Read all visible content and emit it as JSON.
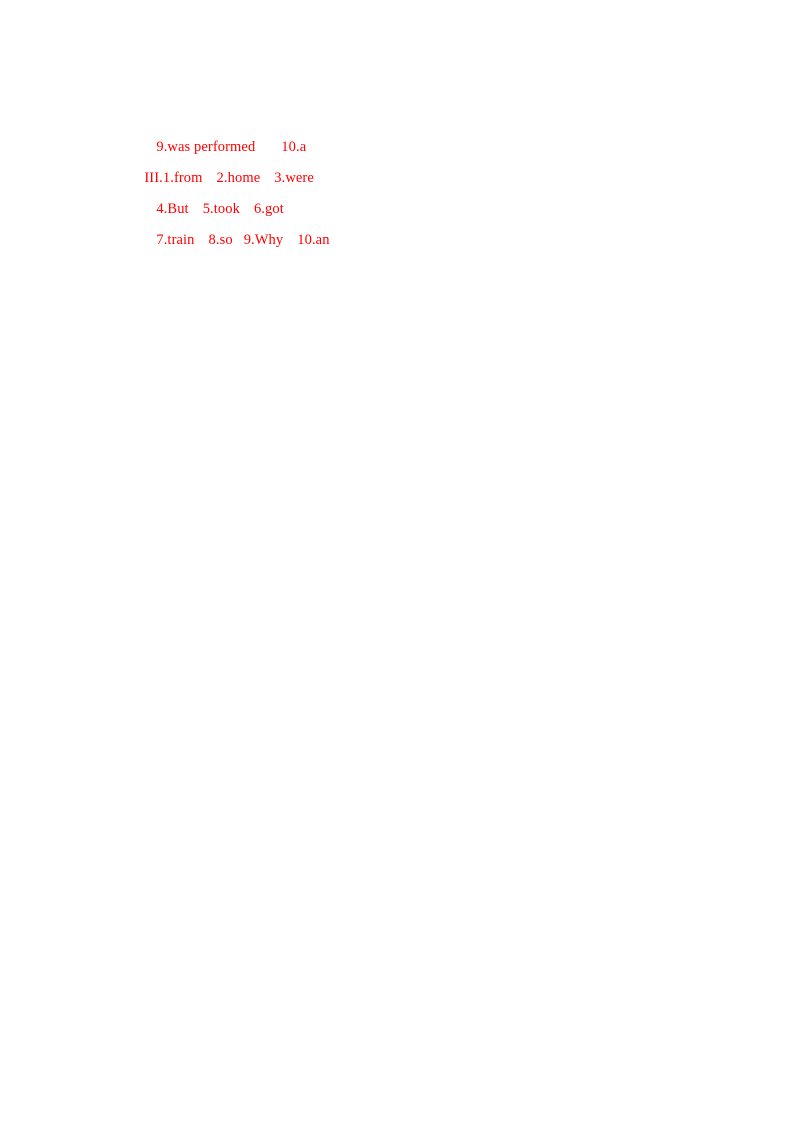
{
  "document": {
    "type": "answer-key",
    "page_background": "#ffffff",
    "ink_color": "#ff0000",
    "lines": [
      {
        "id": "line-1",
        "indent": "deep",
        "section": null,
        "items": [
          {
            "number": "9.",
            "answer": "was performed",
            "text": "9.was performed"
          },
          {
            "number": "10.",
            "answer": "a",
            "text": "10.a"
          }
        ],
        "full_text": "9.was performed      10.a"
      },
      {
        "id": "line-2",
        "indent": "shallow",
        "section": "III.",
        "items": [
          {
            "number": "1.",
            "answer": "from",
            "text": "1.from"
          },
          {
            "number": "2.",
            "answer": "home",
            "text": "2.home"
          },
          {
            "number": "3.",
            "answer": "were",
            "text": "3.were"
          }
        ],
        "full_text": "III.1.from   2.home   3.were"
      },
      {
        "id": "line-3",
        "indent": "deep",
        "section": null,
        "items": [
          {
            "number": "4.",
            "answer": "But",
            "text": "4.But"
          },
          {
            "number": "5.",
            "answer": "took",
            "text": "5.took"
          },
          {
            "number": "6.",
            "answer": "got",
            "text": "6.got"
          }
        ],
        "full_text": "4.But   5.took   6.got"
      },
      {
        "id": "line-4",
        "indent": "deep",
        "section": null,
        "items": [
          {
            "number": "7.",
            "answer": "train",
            "text": "7.train"
          },
          {
            "number": "8.",
            "answer": "so",
            "text": "8.so"
          },
          {
            "number": "9.",
            "answer": "Why",
            "text": "9.Why"
          },
          {
            "number": "10.",
            "answer": "an",
            "text": "10.an"
          }
        ],
        "full_text": "7.train   8.so   9.Why   10.an"
      }
    ]
  }
}
